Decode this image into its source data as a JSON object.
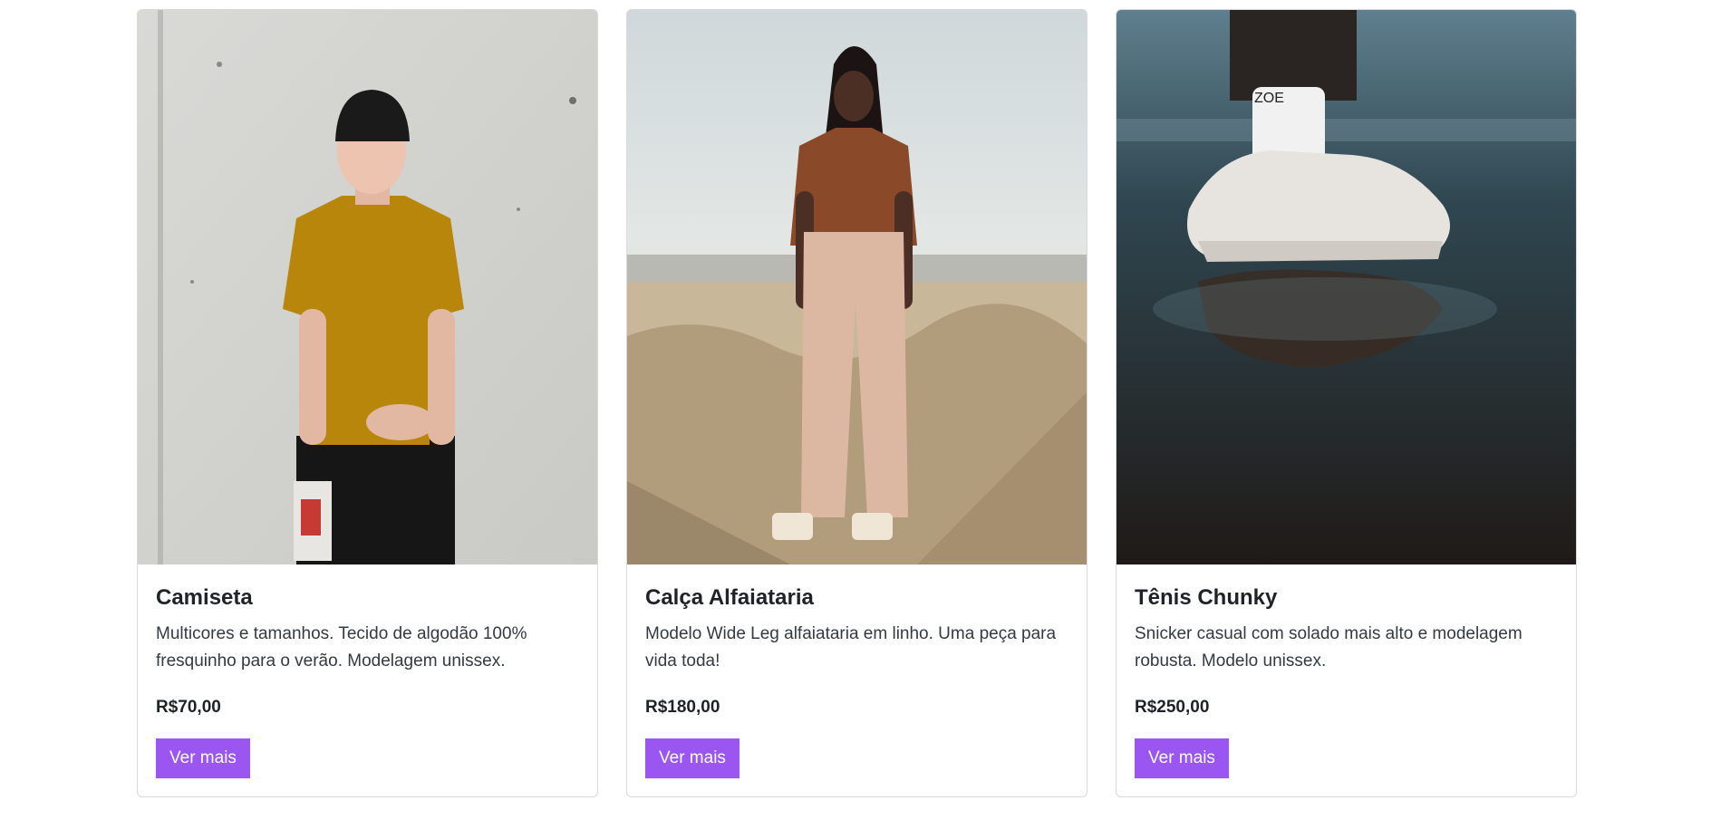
{
  "products": [
    {
      "title": "Camiseta",
      "description": "Multicores e tamanhos. Tecido de algodão 100% fresquinho para o verão. Modelagem unissex.",
      "price": "R$70,00",
      "button_label": "Ver mais",
      "image_name": "man-in-mustard-tshirt-photo"
    },
    {
      "title": "Calça Alfaiataria",
      "description": "Modelo Wide Leg alfaiataria em linho. Uma peça para vida toda!",
      "price": "R$180,00",
      "button_label": "Ver mais",
      "image_name": "woman-in-wide-leg-pants-photo"
    },
    {
      "title": "Tênis Chunky",
      "description": "Snicker casual com solado mais alto e modelagem robusta. Modelo unissex.",
      "price": "R$250,00",
      "button_label": "Ver mais",
      "image_name": "chunky-sneakers-puddle-photo",
      "sock_text": "ZOE"
    }
  ],
  "colors": {
    "accent": "#9b55f0",
    "border": "#d7d9dc"
  }
}
